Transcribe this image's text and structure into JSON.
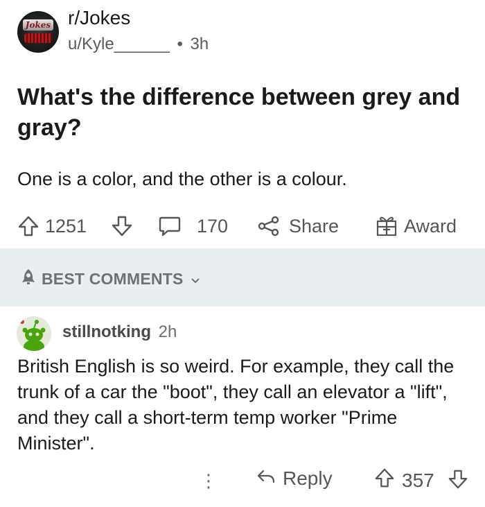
{
  "post": {
    "subreddit": "r/Jokes",
    "subreddit_icon_text": "Jokes",
    "author": "u/Kyle______",
    "separator": "•",
    "age": "3h",
    "title": "What's the difference between grey and gray?",
    "body": "One is a color, and the other is a colour."
  },
  "actions": {
    "score": "1251",
    "comments": "170",
    "share_label": "Share",
    "award_label": "Award"
  },
  "sort": {
    "label": "BEST COMMENTS"
  },
  "comment": {
    "author": "stillnotking",
    "age": "2h",
    "body": "British English is so weird. For example, they call the trunk of a car the \"boot\", they call an elevator a \"lift\", and they call a short-term temp worker \"Prime Minister\".",
    "more_label": "⋮",
    "reply_label": "Reply",
    "score": "357"
  },
  "colors": {
    "text": "#1a1a1b",
    "muted": "#555557",
    "sort_bar_bg": "#e9eef0",
    "sort_text": "#6b7176"
  },
  "icons": {
    "upvote": "upvote-arrow-icon",
    "downvote": "downvote-arrow-icon",
    "comments": "speech-bubble-icon",
    "share": "share-nodes-icon",
    "award": "gift-box-icon",
    "sort": "rocket-icon",
    "chevron": "chevron-down-icon",
    "reply": "reply-arrow-icon",
    "more": "vertical-dots-icon"
  }
}
